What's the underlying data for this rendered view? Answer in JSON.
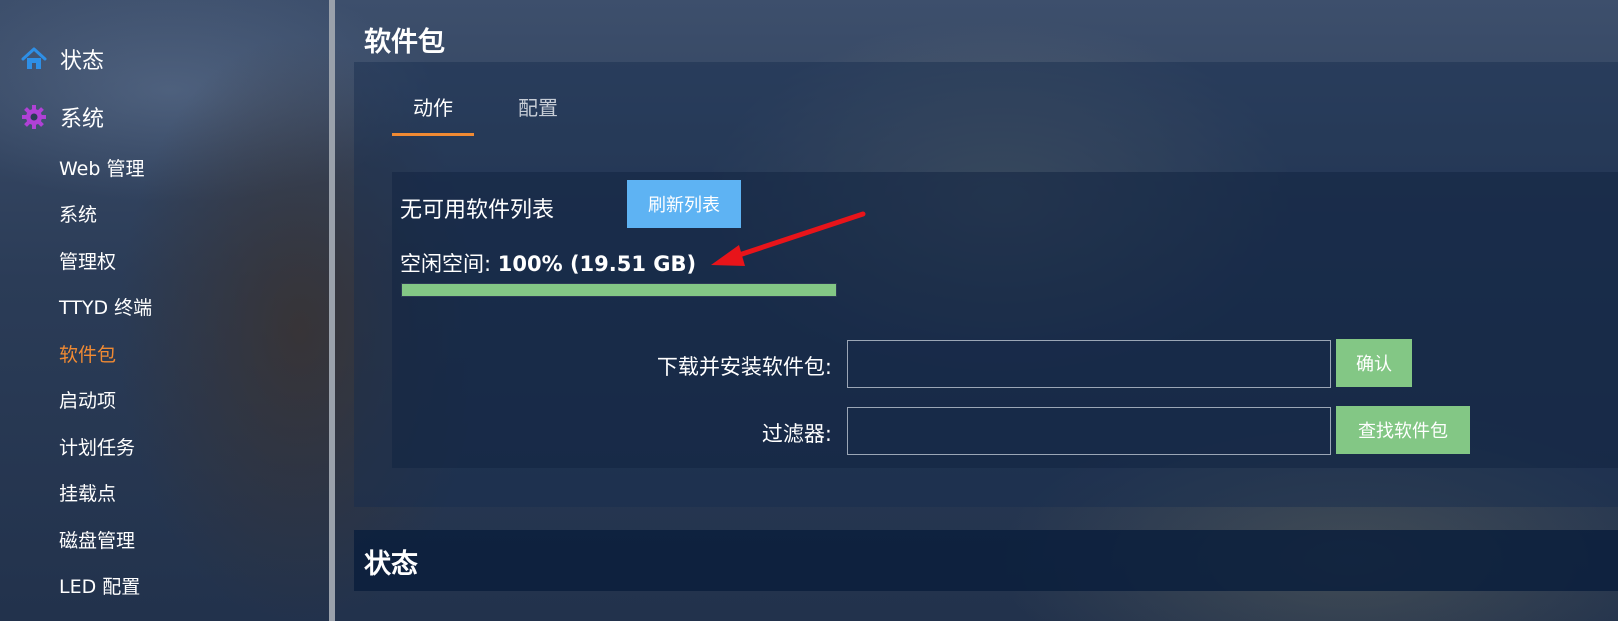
{
  "sidebar": {
    "top_items": [
      {
        "label": "状态",
        "icon": "home-icon",
        "icon_color": "#2e8fe6"
      },
      {
        "label": "系统",
        "icon": "gear-icon",
        "icon_color": "#b041d6"
      }
    ],
    "sub_items": [
      {
        "label": "Web 管理"
      },
      {
        "label": "系统"
      },
      {
        "label": "管理权"
      },
      {
        "label": "TTYD 终端"
      },
      {
        "label": "软件包",
        "active": true
      },
      {
        "label": "启动项"
      },
      {
        "label": "计划任务"
      },
      {
        "label": "挂载点"
      },
      {
        "label": "磁盘管理"
      },
      {
        "label": "LED 配置"
      }
    ]
  },
  "main": {
    "title": "软件包",
    "tabs": [
      {
        "label": "动作",
        "active": true
      },
      {
        "label": "配置"
      }
    ],
    "actions": {
      "no_packages_text": "无可用软件列表",
      "refresh_label": "刷新列表",
      "free_space_label": "空闲空间:",
      "free_space_value": "100% (19.51 GB)",
      "free_space_fraction": 1.0,
      "download_label": "下载并安装软件包:",
      "download_value": "",
      "confirm_label": "确认",
      "filter_label": "过滤器:",
      "filter_value": "",
      "find_label": "查找软件包"
    },
    "status_title": "状态"
  },
  "colors": {
    "accent_orange": "#f08a33",
    "button_blue": "#5eb3f3",
    "button_green": "#83c785",
    "arrow_red": "#e8141a"
  }
}
